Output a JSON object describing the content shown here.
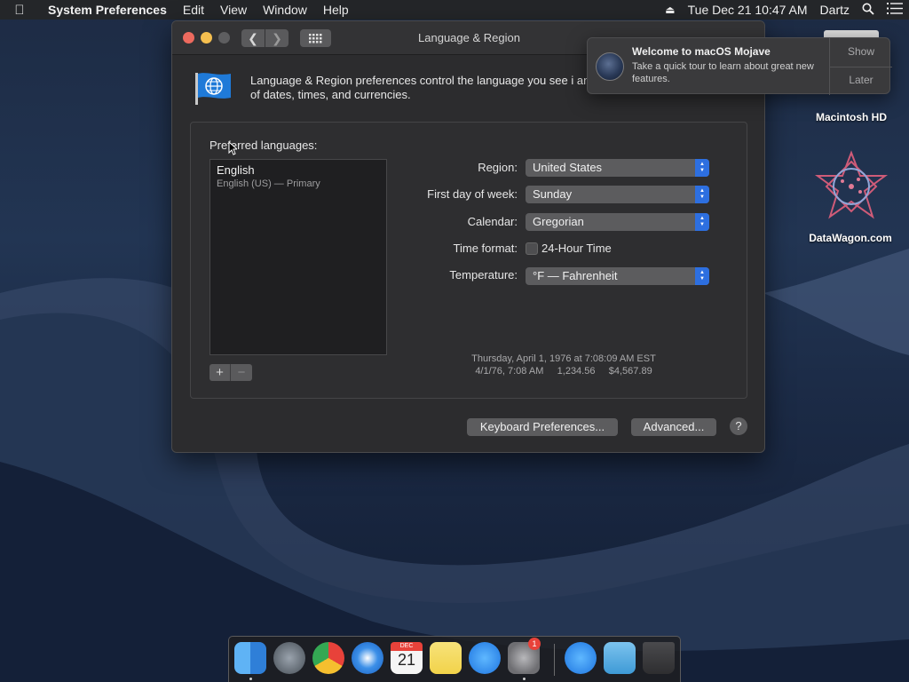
{
  "menubar": {
    "app_name": "System Preferences",
    "menus": [
      "Edit",
      "View",
      "Window",
      "Help"
    ],
    "clock": "Tue Dec 21  10:47 AM",
    "user": "Dartz"
  },
  "window": {
    "title": "Language & Region",
    "intro": "Language & Region preferences control the language you see i and the formats of dates, times, and currencies.",
    "preferred_label": "Preferred languages:",
    "languages": [
      {
        "name": "English",
        "detail": "English (US) — Primary"
      }
    ],
    "region_label": "Region:",
    "region_value": "United States",
    "first_day_label": "First day of week:",
    "first_day_value": "Sunday",
    "calendar_label": "Calendar:",
    "calendar_value": "Gregorian",
    "time_format_label": "Time format:",
    "time_format_checkbox": "24-Hour Time",
    "temperature_label": "Temperature:",
    "temperature_value": "°F — Fahrenheit",
    "sample_line1": "Thursday, April 1, 1976 at 7:08:09 AM EST",
    "sample_line2": "4/1/76, 7:08 AM     1,234.56     $4,567.89",
    "keyboard_button": "Keyboard Preferences...",
    "advanced_button": "Advanced...",
    "help_button": "?",
    "plus": "+",
    "minus": "−"
  },
  "notification": {
    "title": "Welcome to macOS Mojave",
    "body": "Take a quick tour to learn about great new features.",
    "show": "Show",
    "later": "Later"
  },
  "desktop": {
    "hd_label": "Macintosh HD",
    "datawagon_label": "DataWagon.com"
  },
  "dock": {
    "calendar_month": "DEC",
    "calendar_day": "21",
    "sysprefs_badge": "1"
  },
  "colors": {
    "accent": "#2d6fe0",
    "close": "#ed6a5e",
    "minimize": "#f5bf4f"
  }
}
